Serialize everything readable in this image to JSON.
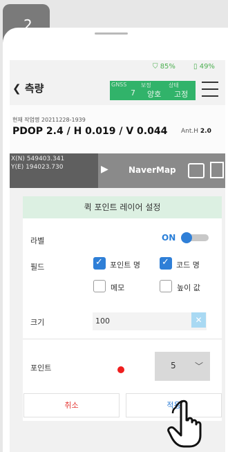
{
  "step": {
    "number": "2"
  },
  "status": {
    "gps_pct": "85%",
    "battery_pct": "49%"
  },
  "appbar": {
    "back_label": "측량",
    "gnss": {
      "label1": "GNSS",
      "value1": "7",
      "label2": "보정",
      "value2": "양호",
      "label3": "상태",
      "value3": "고정"
    }
  },
  "info": {
    "date_text": "현재 작업명 20211228-1939",
    "pdop_text": "PDOP 2.4 / H 0.019 / V 0.044",
    "anth_label": "Ant.H",
    "anth_value": "2.0"
  },
  "map": {
    "coord_x": "X(N) 549403.341",
    "coord_y": "Y(E) 194023.730",
    "map_name": "NaverMap"
  },
  "dialog": {
    "title": "퀵 포인트 레이어 설정",
    "label_row": "라벨",
    "label_state": "ON",
    "field_row": "필드",
    "fields": [
      {
        "label": "포인트 명",
        "checked": true
      },
      {
        "label": "코드 명",
        "checked": true
      },
      {
        "label": "메모",
        "checked": false
      },
      {
        "label": "높이 값",
        "checked": false
      }
    ],
    "size_row": "크기",
    "size_value": "100",
    "point_row": "포인트",
    "point_color": "#ef1e1e",
    "point_select_value": "5",
    "cancel_label": "취소",
    "apply_label": "적용"
  },
  "colors": {
    "accent_blue": "#2f7fd7",
    "gnss_green": "#31b36a",
    "title_bar": "#dcf0e2"
  }
}
